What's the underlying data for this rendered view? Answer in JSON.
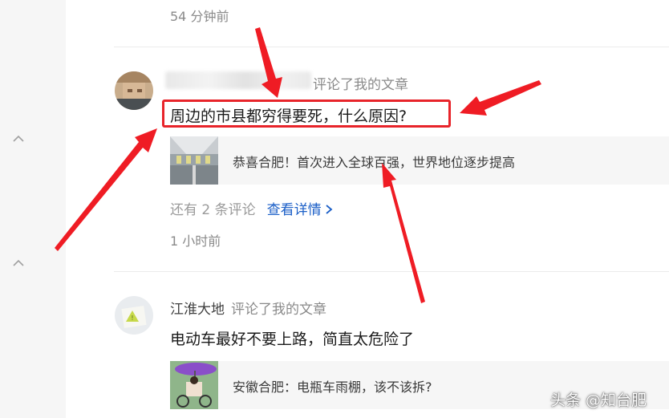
{
  "feed": {
    "top_time": "54 分钟前",
    "items": [
      {
        "username": "",
        "action": "评论了我的文章",
        "comment": "周边的市县都穷得要死，什么原因?",
        "quoted_article": "恭喜合肥！首次进入全球百强，世界地位逐步提高",
        "more_prefix": "还有 2 条评论",
        "more_link": "查看详情",
        "time": "1 小时前"
      },
      {
        "username": "江淮大地",
        "action": "评论了我的文章",
        "comment": "电动车最好不要上路，简直太危险了",
        "quoted_article": "安徽合肥：电瓶车雨棚，该不该拆?"
      }
    ]
  },
  "watermark": "头条 @知台肥",
  "colors": {
    "highlight": "#e8242a",
    "link": "#1a5ec7",
    "rail": "#f6f6f6"
  },
  "icons": [
    "chevron-up-icon",
    "chevron-right-icon",
    "red-arrow-annotation"
  ]
}
